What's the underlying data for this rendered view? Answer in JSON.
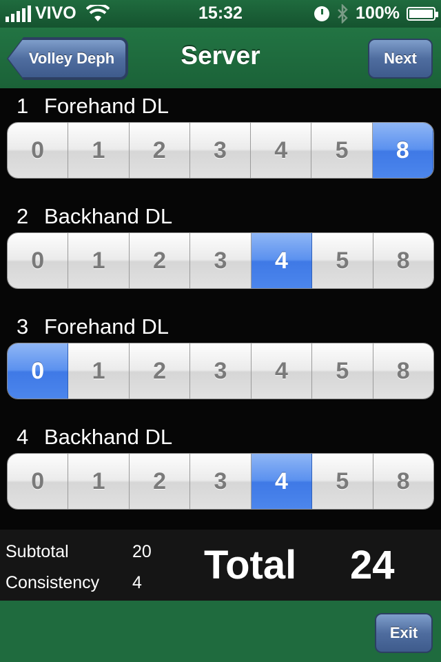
{
  "status_bar": {
    "carrier": "VIVO",
    "time": "15:32",
    "battery": "100%"
  },
  "nav": {
    "back_label": "Volley Deph",
    "title": "Server",
    "next_label": "Next"
  },
  "rows": [
    {
      "number": "1",
      "label": "Forehand DL",
      "options": [
        "0",
        "1",
        "2",
        "3",
        "4",
        "5",
        "8"
      ],
      "selected": "8"
    },
    {
      "number": "2",
      "label": "Backhand DL",
      "options": [
        "0",
        "1",
        "2",
        "3",
        "4",
        "5",
        "8"
      ],
      "selected": "4"
    },
    {
      "number": "3",
      "label": "Forehand DL",
      "options": [
        "0",
        "1",
        "2",
        "3",
        "4",
        "5",
        "8"
      ],
      "selected": "0"
    },
    {
      "number": "4",
      "label": "Backhand DL",
      "options": [
        "0",
        "1",
        "2",
        "3",
        "4",
        "5",
        "8"
      ],
      "selected": "4"
    }
  ],
  "totals": {
    "subtotal_label": "Subtotal",
    "subtotal_value": "20",
    "consistency_label": "Consistency",
    "consistency_value": "4",
    "total_label": "Total",
    "total_value": "24"
  },
  "bottom": {
    "exit_label": "Exit"
  },
  "colors": {
    "nav_green": "#1f6b3e",
    "button_blue": "#4f6d9f",
    "selected_blue": "#4c86ec"
  }
}
